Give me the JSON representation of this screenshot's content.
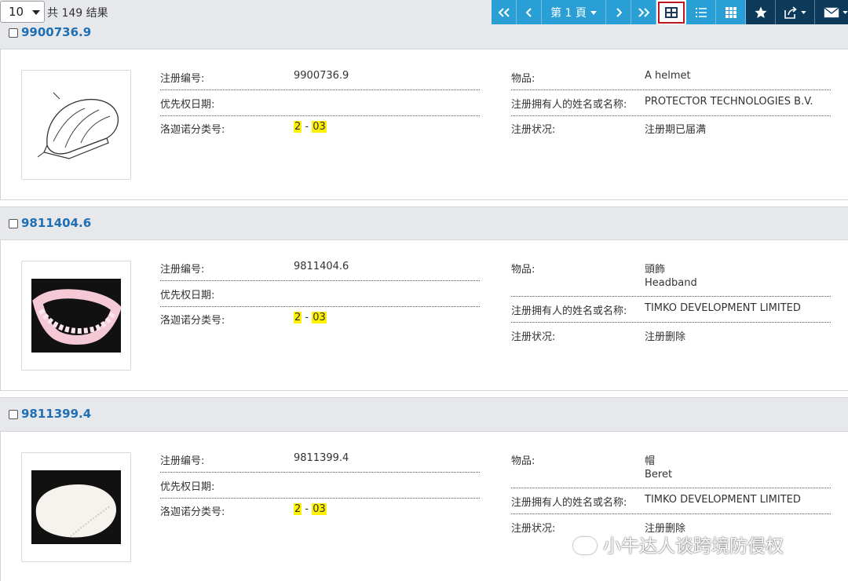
{
  "toolbar": {
    "per_page": "10",
    "total": "共 149 结果",
    "pager_label": "第 1 頁"
  },
  "labels": {
    "reg_no": "注册编号:",
    "priority": "优先权日期:",
    "locarno": "洛迦诺分类号:",
    "product": "物品:",
    "owner": "注册拥有人的姓名或名称:",
    "status": "注册状况:"
  },
  "records": [
    {
      "id": "9900736.9",
      "reg_no": "9900736.9",
      "priority": "",
      "locarno_a": "2",
      "locarno_sep": " - ",
      "locarno_b": "03",
      "product_1": "A helmet",
      "product_2": "",
      "owner": "PROTECTOR TECHNOLOGIES B.V.",
      "status": "注册期已届满"
    },
    {
      "id": "9811404.6",
      "reg_no": "9811404.6",
      "priority": "",
      "locarno_a": "2",
      "locarno_sep": " - ",
      "locarno_b": "03",
      "product_1": "頭飾",
      "product_2": "Headband",
      "owner": "TIMKO DEVELOPMENT LIMITED",
      "status": "注册删除"
    },
    {
      "id": "9811399.4",
      "reg_no": "9811399.4",
      "priority": "",
      "locarno_a": "2",
      "locarno_sep": " - ",
      "locarno_b": "03",
      "product_1": "帽",
      "product_2": "Beret",
      "owner": "TIMKO DEVELOPMENT LIMITED",
      "status": "注册删除"
    }
  ],
  "watermark": "小牛达人谈跨境防侵权"
}
